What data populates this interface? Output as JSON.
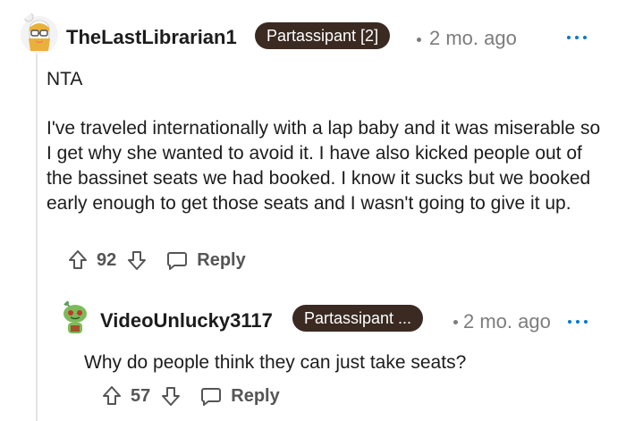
{
  "comment": {
    "username": "TheLastLibrarian1",
    "flair": "Partassipant [2]",
    "time": "2 mo. ago",
    "verdict": "NTA",
    "body": "I've traveled internationally with a lap baby and it was miserable so I get why she wanted to avoid it. I have also kicked people out of the bassinet seats we had booked. I know it sucks but we booked early enough to get those seats and I wasn't going to give it up.",
    "score": "92",
    "reply_label": "Reply"
  },
  "reply": {
    "username": "VideoUnlucky3117",
    "flair": "Partassipant ...",
    "time": "2 mo. ago",
    "body": "Why do people think they can just take seats?",
    "score": "57",
    "reply_label": "Reply"
  },
  "icons": {
    "upvote": "upvote-arrow-icon",
    "downvote": "downvote-arrow-icon",
    "reply": "speech-bubble-icon",
    "more": "more-options-icon"
  },
  "colors": {
    "flair_bg": "#3a2a22",
    "meta_gray": "#7c7c7c",
    "action_gray": "#555555",
    "more_blue": "#0079d3"
  }
}
